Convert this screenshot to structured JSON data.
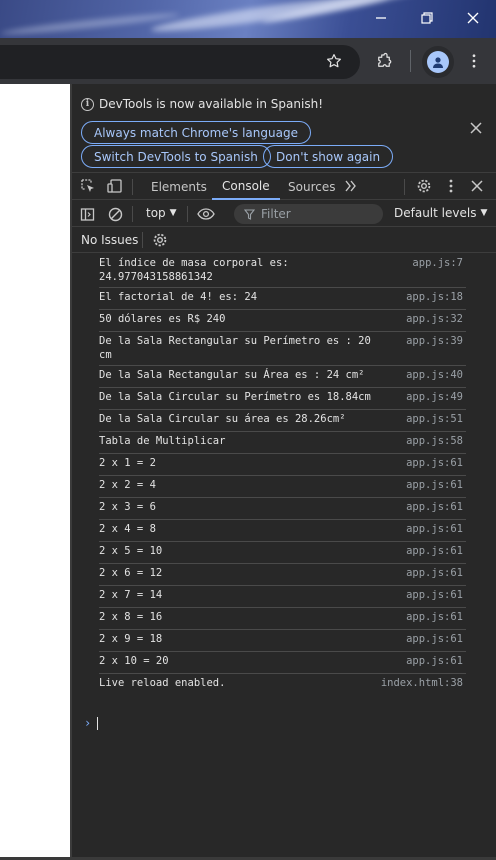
{
  "window": {
    "controls": [
      "minimize-icon",
      "restore-icon",
      "close-icon"
    ]
  },
  "toolbar": {
    "icons": [
      "star-icon",
      "extensions-icon",
      "profile-icon",
      "more-vert-icon"
    ]
  },
  "infobar": {
    "message": "DevTools is now available in Spanish!",
    "buttons": {
      "match_language": "Always match Chrome's language",
      "switch_spanish": "Switch DevTools to Spanish",
      "dont_show": "Don't show again"
    }
  },
  "tabs": {
    "elements": "Elements",
    "console": "Console",
    "sources": "Sources",
    "active": "Console"
  },
  "filterbar": {
    "context": "top",
    "filter_placeholder": "Filter",
    "levels": "Default levels"
  },
  "issues": {
    "label": "No Issues"
  },
  "console": {
    "messages": [
      {
        "text": "El índice de masa corporal es:\n24.977043158861342",
        "source": "app.js:7"
      },
      {
        "text": "El factorial de 4! es: 24",
        "source": "app.js:18"
      },
      {
        "text": "50 dólares es R$ 240",
        "source": "app.js:32"
      },
      {
        "text": "De la Sala Rectangular su Perímetro es : 20\ncm",
        "source": "app.js:39"
      },
      {
        "text": "De la Sala Rectangular su Área es : 24 cm²",
        "source": "app.js:40"
      },
      {
        "text": "De la Sala Circular su Perímetro es 18.84cm",
        "source": "app.js:49"
      },
      {
        "text": "De la Sala Circular su área es 28.26cm²",
        "source": "app.js:51"
      },
      {
        "text": "Tabla de Multiplicar",
        "source": "app.js:58"
      },
      {
        "text": "2 x 1 = 2",
        "source": "app.js:61"
      },
      {
        "text": "2 x 2 = 4",
        "source": "app.js:61"
      },
      {
        "text": "2 x 3 = 6",
        "source": "app.js:61"
      },
      {
        "text": "2 x 4 = 8",
        "source": "app.js:61"
      },
      {
        "text": "2 x 5 = 10",
        "source": "app.js:61"
      },
      {
        "text": "2 x 6 = 12",
        "source": "app.js:61"
      },
      {
        "text": "2 x 7 = 14",
        "source": "app.js:61"
      },
      {
        "text": "2 x 8 = 16",
        "source": "app.js:61"
      },
      {
        "text": "2 x 9 = 18",
        "source": "app.js:61"
      },
      {
        "text": "2 x 10 = 20",
        "source": "app.js:61"
      },
      {
        "text": "Live reload enabled.",
        "source": "index.html:38"
      }
    ]
  },
  "colors": {
    "accent": "#7cacf8",
    "background": "#282828",
    "text": "#e3e3e3",
    "source_text": "#9aa0a6"
  }
}
